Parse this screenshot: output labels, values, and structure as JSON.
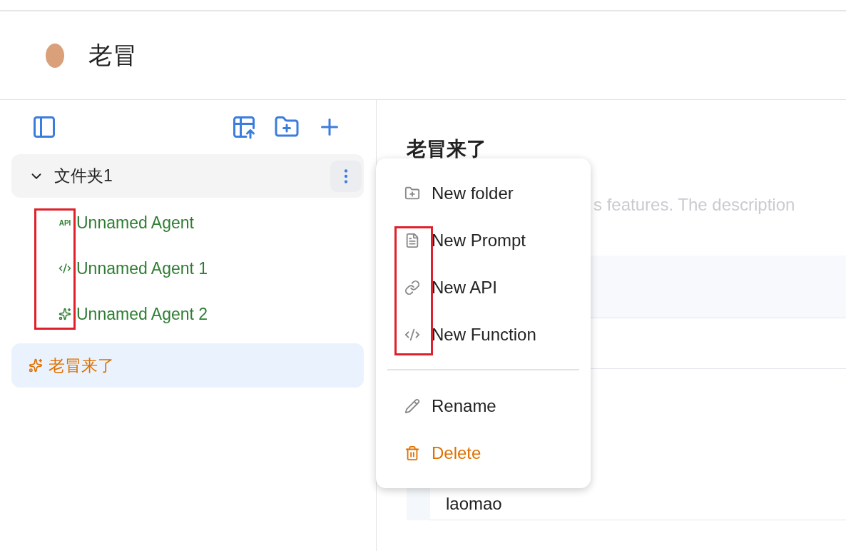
{
  "header": {
    "title": "老冒"
  },
  "sidebar": {
    "tree": [
      {
        "name": "文件夹1",
        "kind": "folder",
        "expanded": true,
        "children": [
          {
            "name": "Unnamed Agent",
            "kind": "api",
            "icon_text": "API",
            "selected": false
          },
          {
            "name": "Unnamed Agent 1",
            "kind": "function",
            "selected": false
          },
          {
            "name": "Unnamed Agent 2",
            "kind": "prompt",
            "selected": false
          }
        ]
      },
      {
        "name": "老冒来了",
        "kind": "prompt",
        "selected": true
      }
    ]
  },
  "context_menu": {
    "groups": [
      [
        {
          "label": "New folder",
          "kind": "folder"
        },
        {
          "label": "New Prompt",
          "kind": "prompt"
        },
        {
          "label": "New API",
          "kind": "api"
        },
        {
          "label": "New Function",
          "kind": "function"
        }
      ],
      [
        {
          "label": "Rename",
          "kind": "rename"
        },
        {
          "label": "Delete",
          "kind": "delete"
        }
      ]
    ]
  },
  "main": {
    "title": "老冒来了",
    "description": "s features. The description",
    "table": {
      "rows": [
        {
          "value": "laomao"
        }
      ]
    }
  }
}
